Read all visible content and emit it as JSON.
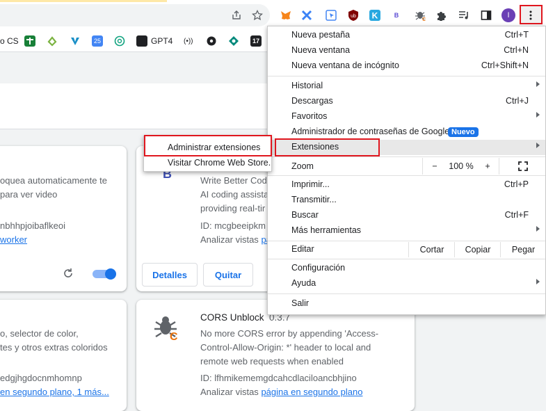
{
  "bookmarks": [
    {
      "label": "o CS"
    },
    {
      "label": ""
    },
    {
      "label": ""
    },
    {
      "label": ""
    },
    {
      "label": "25"
    },
    {
      "label": ""
    },
    {
      "label": "GPT4"
    },
    {
      "label": "(•))"
    },
    {
      "label": ""
    },
    {
      "label": ""
    },
    {
      "label": "17"
    }
  ],
  "toolbar": {
    "profile_initial": "I",
    "ext_b_label": "B"
  },
  "cards": {
    "card1": {
      "desc_line1": "oquea automaticamente te",
      "desc_line2": "para ver video",
      "id_text": "nbhhpjoibaflkeoi",
      "inspect_link": "worker"
    },
    "card2": {
      "icon_letter": "B",
      "desc_line1": "Write Better Cod",
      "desc_line2": "AI coding assista",
      "desc_line3": "providing real-tir",
      "id_text": "ID: mcgbeeipkm",
      "inspect_label": "Analizar vistas",
      "inspect_link": "pá",
      "details_button": "Detalles",
      "remove_button": "Quitar"
    },
    "card3": {
      "desc_line1": "o, selector de color,",
      "desc_line2": "tes y otros extras coloridos",
      "id_text": "edgjhgdocnmhomnp",
      "inspect_link": "en segundo plano, 1 más..."
    },
    "card4": {
      "name": "CORS Unblock",
      "version": "0.3.7",
      "desc_line1": "No more CORS error by appending 'Access-",
      "desc_line2": "Control-Allow-Origin: *' header to local and",
      "desc_line3": "remote web requests when enabled",
      "id_text": "ID: lfhmikememgdcahcdlaciloancbhjino",
      "inspect_label": "Analizar vistas",
      "inspect_link": "página en segundo plano"
    }
  },
  "menu": {
    "new_tab": "Nueva pestaña",
    "new_tab_sc": "Ctrl+T",
    "new_window": "Nueva ventana",
    "new_window_sc": "Ctrl+N",
    "incognito": "Nueva ventana de incógnito",
    "incognito_sc": "Ctrl+Shift+N",
    "history": "Historial",
    "downloads": "Descargas",
    "downloads_sc": "Ctrl+J",
    "bookmarks": "Favoritos",
    "passwords": "Administrador de contraseñas de Google",
    "new_badge": "Nuevo",
    "extensions": "Extensiones",
    "zoom": "Zoom",
    "zoom_minus": "−",
    "zoom_value": "100 %",
    "zoom_plus": "+",
    "print": "Imprimir...",
    "print_sc": "Ctrl+P",
    "cast": "Transmitir...",
    "find": "Buscar",
    "find_sc": "Ctrl+F",
    "more_tools": "Más herramientas",
    "edit": "Editar",
    "cut": "Cortar",
    "copy": "Copiar",
    "paste": "Pegar",
    "settings": "Configuración",
    "help": "Ayuda",
    "exit": "Salir"
  },
  "submenu": {
    "manage": "Administrar extensiones",
    "webstore": "Visitar Chrome Web Store."
  },
  "colors": {
    "accent": "#1a73e8",
    "highlight_red": "#e0161e"
  }
}
